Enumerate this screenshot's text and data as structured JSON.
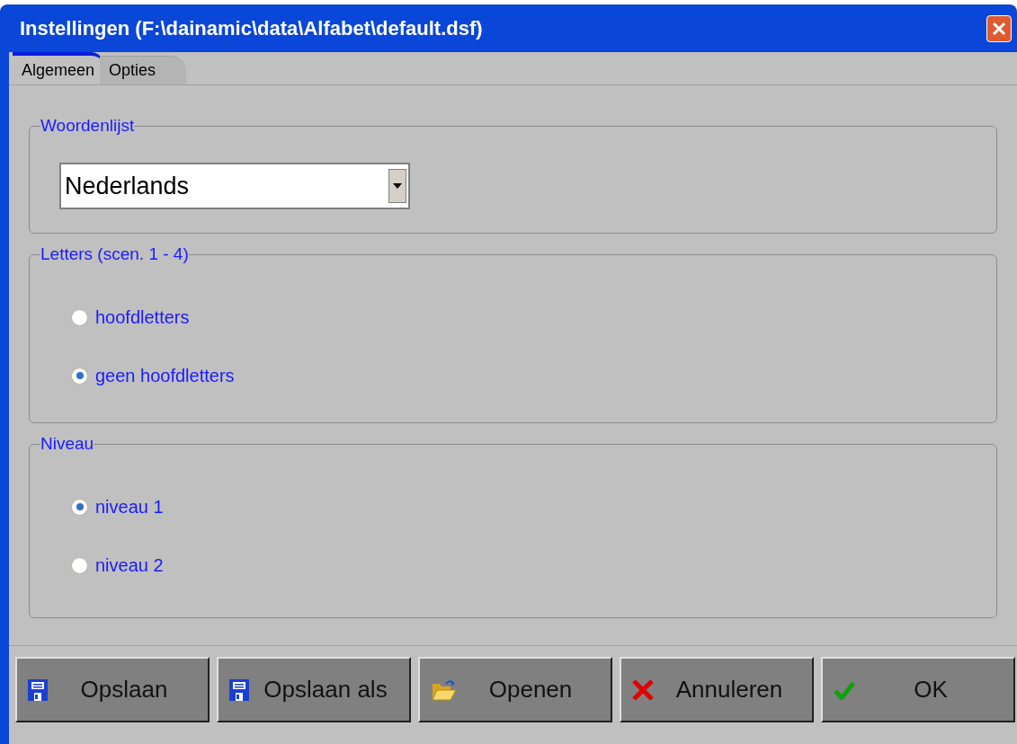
{
  "window": {
    "title": "Instellingen (F:\\dainamic\\data\\Alfabet\\default.dsf)"
  },
  "tabs": [
    {
      "label": "Algemeen",
      "selected": true
    },
    {
      "label": "Opties",
      "selected": false
    }
  ],
  "groups": [
    {
      "title": "Woordenlijst",
      "kind": "dropdown",
      "value": "Nederlands"
    },
    {
      "title": "Letters (scen. 1 - 4)",
      "kind": "radios",
      "options": [
        {
          "label": "hoofdletters",
          "selected": false
        },
        {
          "label": "geen hoofdletters",
          "selected": true
        }
      ]
    },
    {
      "title": "Niveau",
      "kind": "radios",
      "options": [
        {
          "label": "niveau 1",
          "selected": true
        },
        {
          "label": "niveau 2",
          "selected": false
        }
      ]
    }
  ],
  "buttons": [
    {
      "label": "Opslaan",
      "kind": "save"
    },
    {
      "label": "Opslaan als",
      "kind": "save"
    },
    {
      "label": "Openen",
      "kind": "open"
    },
    {
      "label": "Annuleren",
      "kind": "cancel"
    },
    {
      "label": "OK",
      "kind": "ok"
    }
  ]
}
